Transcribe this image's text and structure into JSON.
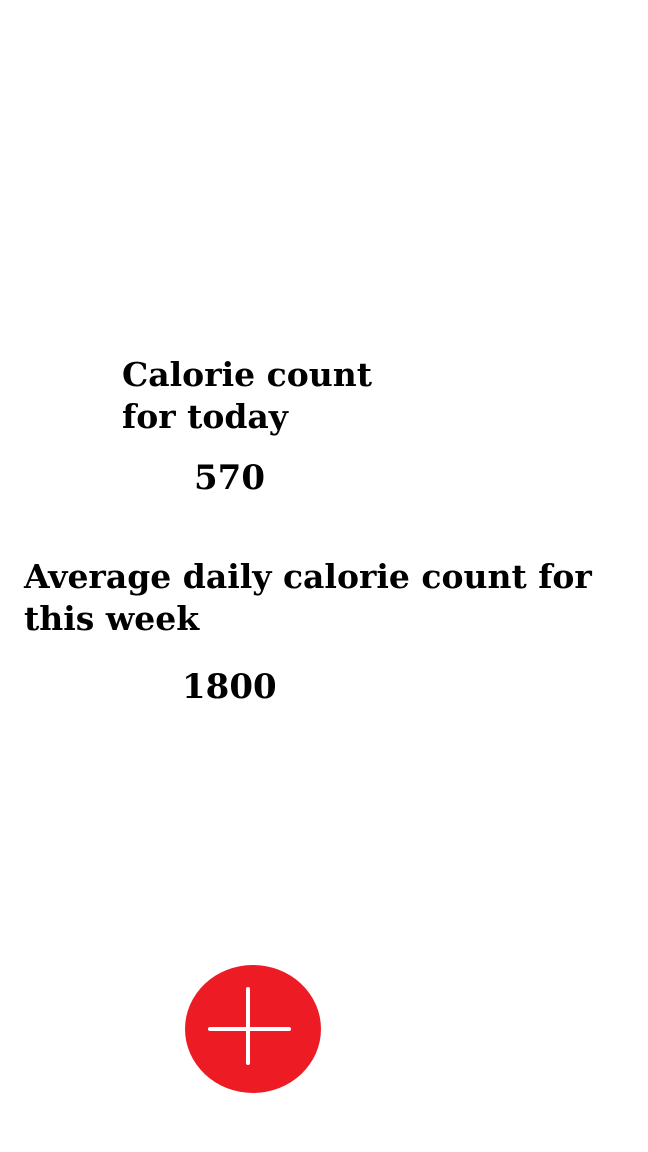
{
  "today": {
    "heading_line1": "Calorie count",
    "heading_line2": "for today",
    "value": "570"
  },
  "week": {
    "heading_line1": "Average daily calorie count for",
    "heading_line2": "this week",
    "value": "1800"
  },
  "add_button": {
    "icon": "plus-icon",
    "color": "#ed1c24",
    "icon_color": "#ffffff"
  }
}
